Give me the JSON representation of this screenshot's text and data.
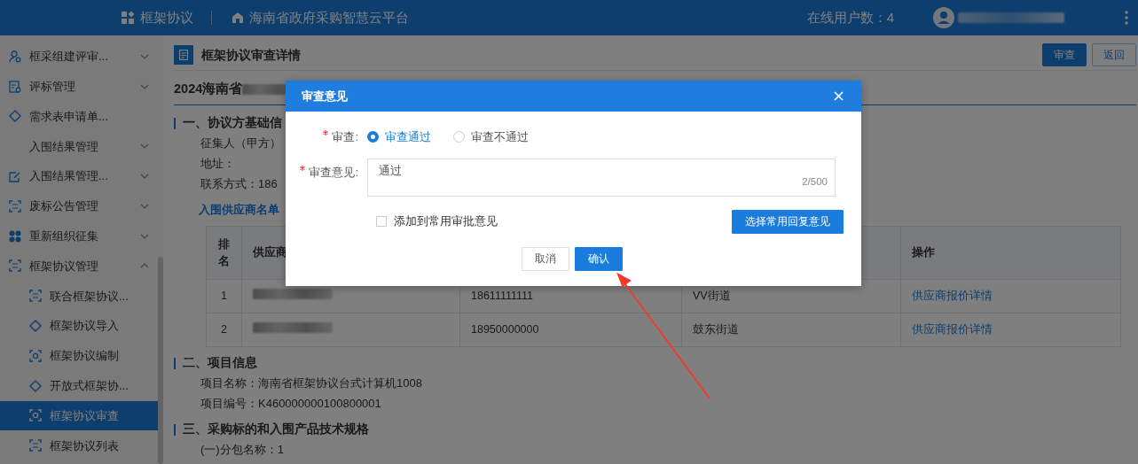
{
  "header": {
    "module": "框架协议",
    "platform": "海南省政府采购智慧云平台",
    "online_users": "在线用户数：4"
  },
  "sidebar": {
    "items": [
      {
        "label": "框采组建评审...",
        "kind": "group",
        "expanded": false,
        "selected": false
      },
      {
        "label": "评标管理",
        "kind": "group",
        "expanded": false,
        "selected": false
      },
      {
        "label": "需求表申请单...",
        "kind": "link",
        "selected": false
      },
      {
        "label": "入围结果管理",
        "kind": "group",
        "expanded": false,
        "selected": false
      },
      {
        "label": "入围结果管理...",
        "kind": "group",
        "expanded": false,
        "selected": false
      },
      {
        "label": "废标公告管理",
        "kind": "group",
        "expanded": false,
        "selected": false
      },
      {
        "label": "重新组织征集",
        "kind": "group",
        "expanded": false,
        "selected": false
      },
      {
        "label": "框架协议管理",
        "kind": "group",
        "expanded": true,
        "selected": false,
        "children": [
          {
            "label": "联合框架协议...",
            "selected": false
          },
          {
            "label": "框架协议导入",
            "selected": false
          },
          {
            "label": "框架协议编制",
            "selected": false
          },
          {
            "label": "开放式框架协...",
            "selected": false
          },
          {
            "label": "框架协议审查",
            "selected": true
          },
          {
            "label": "框架协议列表",
            "selected": false
          }
        ]
      }
    ]
  },
  "page": {
    "title": "框架协议审查详情",
    "buttons": [
      {
        "label": "审查",
        "kind": "primary"
      },
      {
        "label": "返回",
        "kind": "outline"
      }
    ],
    "project_title": "2024海南省",
    "section_1": {
      "heading": "一、协议方基础信",
      "lines": [
        "征集人（甲方）",
        "地址：",
        "联系方式：186"
      ]
    },
    "supplier_list": {
      "title": "入围供应商名单",
      "columns": [
        "排名",
        "供应商",
        null,
        null,
        "操作"
      ],
      "rows": [
        {
          "rank": "1",
          "phone": "18611111111",
          "street": "VV街道",
          "action": "供应商报价详情"
        },
        {
          "rank": "2",
          "phone": "18950000000",
          "street": "鼓东街道",
          "action": "供应商报价详情"
        }
      ]
    },
    "section_2": {
      "heading": "二、项目信息",
      "lines": [
        "项目名称：海南省框架协议台式计算机1008",
        "项目编号：K460000000100800001"
      ]
    },
    "section_3": {
      "heading": "三、采购标的和入围产品技术规格",
      "lines": [
        "(一)分包名称：1"
      ]
    }
  },
  "dialog": {
    "title": "审查意见",
    "review": {
      "label": "审查:",
      "required": true,
      "options": [
        {
          "label": "审查通过",
          "selected": true
        },
        {
          "label": "审查不通过",
          "selected": false
        }
      ]
    },
    "opinion": {
      "label": "审查意见:",
      "required": true,
      "value": "通过",
      "counter": "2/500"
    },
    "save_as_common": {
      "label": "添加到常用审批意见",
      "checked": false
    },
    "choose_button": "选择常用回复意见",
    "buttons": [
      {
        "label": "取消",
        "kind": "default"
      },
      {
        "label": "确认",
        "kind": "primary"
      }
    ]
  }
}
